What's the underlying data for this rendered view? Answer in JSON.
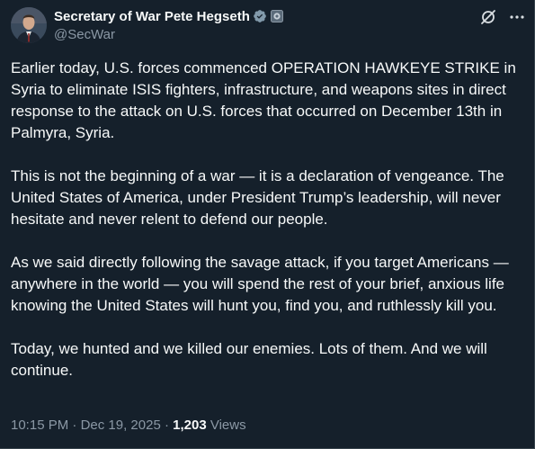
{
  "author": {
    "display_name": "Secretary of War Pete Hegseth",
    "handle": "@SecWar",
    "verified_icon": "verified-badge-icon",
    "affiliation_icon": "government-affiliation-icon"
  },
  "actions": {
    "grok_icon": "grok-icon",
    "more_icon": "more-options-icon"
  },
  "post": {
    "paragraphs": [
      "Earlier today, U.S. forces commenced OPERATION HAWKEYE STRIKE in Syria to eliminate ISIS fighters, infrastructure, and weapons sites in direct response to the attack on U.S. forces that occurred on December 13th in Palmyra, Syria.",
      "This is not the beginning of a war — it is a declaration of vengeance. The United States of America, under President Trump’s leadership, will never hesitate and never relent to defend our people.",
      "As we said directly following the savage attack, if you target Americans — anywhere in the world — you will spend the rest of your brief, anxious life knowing the United States will hunt you, find you, and ruthlessly kill you.",
      "Today, we hunted and we killed our enemies. Lots of them. And we will continue."
    ]
  },
  "meta": {
    "time": "10:15 PM",
    "sep1": " · ",
    "date": "Dec 19, 2025",
    "sep2": " · ",
    "views_count": "1,203",
    "views_label": " Views"
  },
  "colors": {
    "background": "#15202b",
    "text": "#f7f9f9",
    "muted": "#8b98a5",
    "verified": "#829aab"
  }
}
